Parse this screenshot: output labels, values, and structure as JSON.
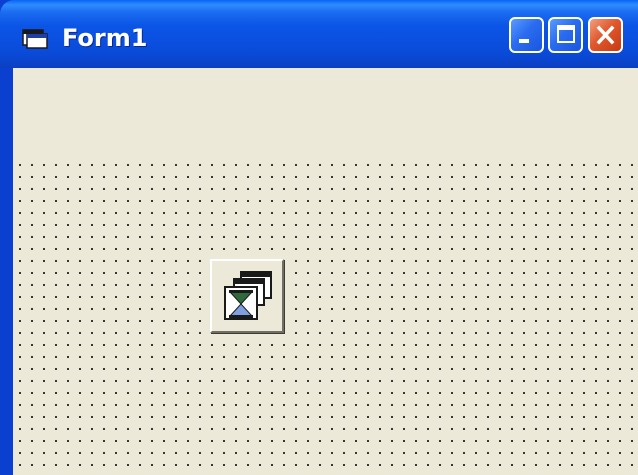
{
  "window": {
    "title": "Form1",
    "icon": "form-icon"
  },
  "title_buttons": {
    "minimize_icon": "minimize-icon",
    "maximize_icon": "maximize-icon",
    "close_icon": "close-icon"
  },
  "designer": {
    "control_icon": "animation-control-icon"
  },
  "colors": {
    "titlebar": "#0b55e6",
    "client_background": "#ece9d8",
    "close_button": "#e0582d"
  }
}
